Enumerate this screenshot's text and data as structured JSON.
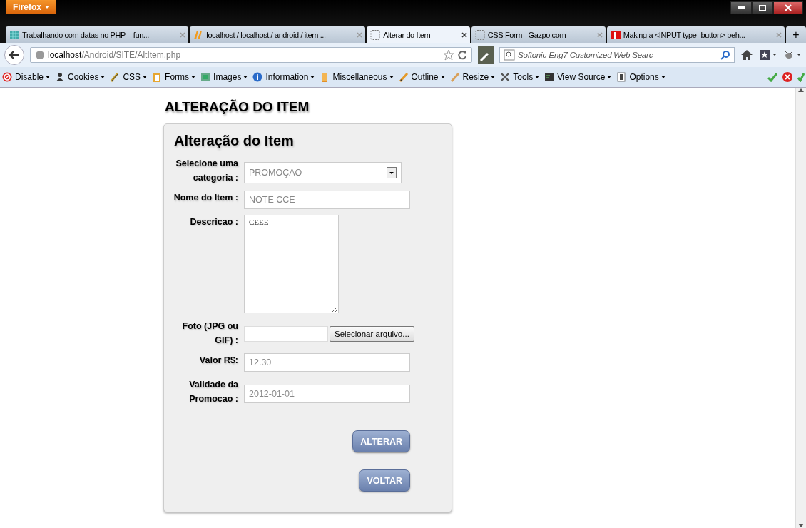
{
  "window": {
    "app_button": "Firefox"
  },
  "tabs": [
    {
      "label": "Trabalhando com datas no PHP – fun...",
      "selected": false
    },
    {
      "label": "localhost / localhost / android / item ...",
      "selected": false
    },
    {
      "label": "Alterar do Item",
      "selected": true
    },
    {
      "label": "CSS Form - Gazpo.com",
      "selected": false
    },
    {
      "label": "Making a <INPUT type=button> beh...",
      "selected": false
    }
  ],
  "new_tab": "+",
  "address": {
    "host": "localhost",
    "path": "/Android/SITE/AltItem.php"
  },
  "search": {
    "placeholder": "Softonic-Eng7 Customized Web Searc"
  },
  "addon_toolbar": [
    "Disable",
    "Cookies",
    "CSS",
    "Forms",
    "Images",
    "Information",
    "Miscellaneous",
    "Outline",
    "Resize",
    "Tools",
    "View Source",
    "Options"
  ],
  "page": {
    "heading": "ALTERAÇÃO DO ITEM",
    "form": {
      "title": "Alteração do Item",
      "fields": [
        {
          "kind": "select",
          "label": "Selecione uma categoria :",
          "value": "PROMOÇÃO"
        },
        {
          "kind": "text",
          "label": "Nome do Item :",
          "value": "NOTE CCE"
        },
        {
          "kind": "textarea",
          "label": "Descricao :",
          "value": "CEEE"
        },
        {
          "kind": "file",
          "label": "Foto (JPG ou GIF) :",
          "button": "Selecionar arquivo..."
        },
        {
          "kind": "text",
          "label": "Valor R$:",
          "value": "12.30"
        },
        {
          "kind": "text",
          "label": "Validade da Promocao :",
          "value": "2012-01-01"
        }
      ],
      "buttons": [
        "ALTERAR",
        "VOLTAR"
      ]
    }
  }
}
